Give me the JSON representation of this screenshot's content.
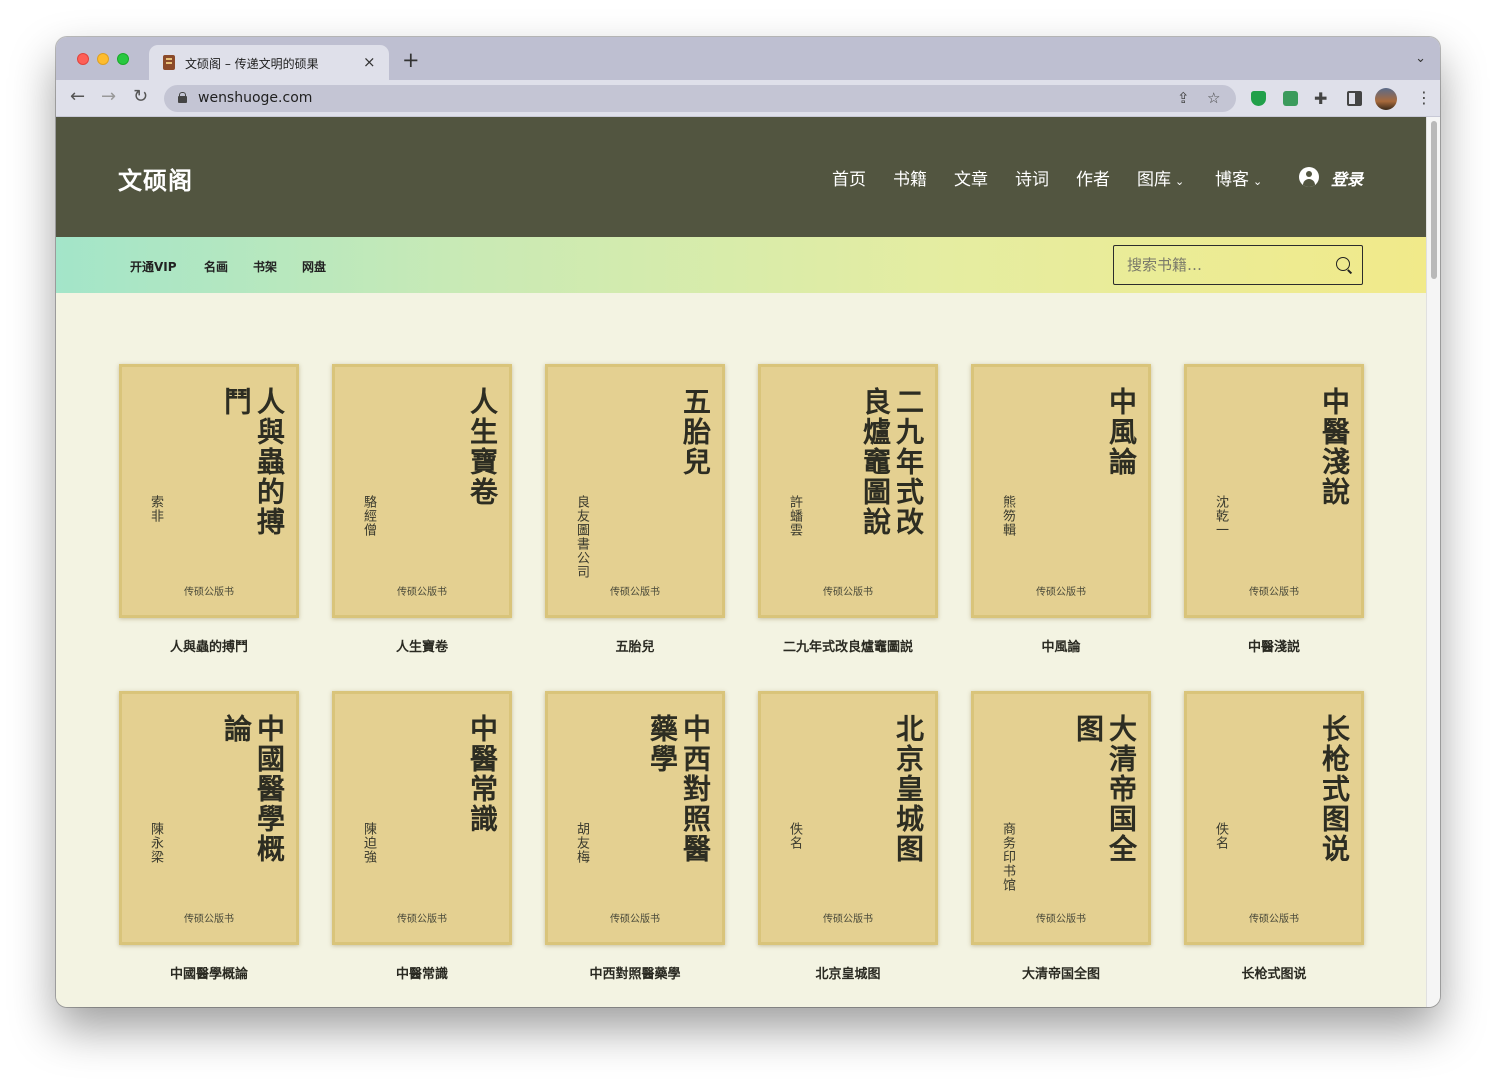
{
  "browser": {
    "tab_title": "文硕阁 – 传递文明的硕果",
    "tab_close": "×",
    "new_tab": "+",
    "tab_menu": "⌄",
    "url": "wenshuoge.com",
    "back": "←",
    "forward": "→",
    "reload": "↻",
    "share": "⇪",
    "star": "☆",
    "extensions": "✚",
    "menu": "⋮"
  },
  "header": {
    "logo": "文硕阁",
    "nav": [
      {
        "label": "首页"
      },
      {
        "label": "书籍"
      },
      {
        "label": "文章"
      },
      {
        "label": "诗词"
      },
      {
        "label": "作者"
      },
      {
        "label": "图库"
      },
      {
        "label": "博客"
      }
    ],
    "caret": "⌄",
    "login": "登录"
  },
  "subbar": {
    "links": [
      "开通VIP",
      "名画",
      "书架",
      "网盘"
    ],
    "search_placeholder": "搜索书籍…"
  },
  "books": [
    {
      "cover_title": "人與蟲的搏鬥",
      "author": "索非",
      "publisher": "传硕公版书",
      "name": "人與蟲的搏鬥"
    },
    {
      "cover_title": "人生寶卷",
      "author": "駱經僧",
      "publisher": "传硕公版书",
      "name": "人生寶卷"
    },
    {
      "cover_title": "五胎兒",
      "author": "良友圖書公司",
      "publisher": "传硕公版书",
      "name": "五胎兒"
    },
    {
      "cover_title": "二九年式改良爐竈圖說",
      "author": "許蟠雲",
      "publisher": "传硕公版书",
      "name": "二九年式改良爐竈圖説"
    },
    {
      "cover_title": "中風論",
      "author": "熊笏輯",
      "publisher": "传硕公版书",
      "name": "中風論"
    },
    {
      "cover_title": "中醫淺說",
      "author": "沈乾一",
      "publisher": "传硕公版书",
      "name": "中醫淺説"
    },
    {
      "cover_title": "中國醫學概論",
      "author": "陳永梁",
      "publisher": "传硕公版书",
      "name": "中國醫學概論"
    },
    {
      "cover_title": "中醫常識",
      "author": "陳迫強",
      "publisher": "传硕公版书",
      "name": "中醫常識"
    },
    {
      "cover_title": "中西對照醫藥學",
      "author": "胡友梅",
      "publisher": "传硕公版书",
      "name": "中西對照醫藥學"
    },
    {
      "cover_title": "北京皇城图",
      "author": "佚名",
      "publisher": "传硕公版书",
      "name": "北京皇城图"
    },
    {
      "cover_title": "大清帝国全图",
      "author": "商务印书馆",
      "publisher": "传硕公版书",
      "name": "大清帝国全图"
    },
    {
      "cover_title": "长枪式图说",
      "author": "佚名",
      "publisher": "传硕公版书",
      "name": "长枪式图说"
    }
  ]
}
